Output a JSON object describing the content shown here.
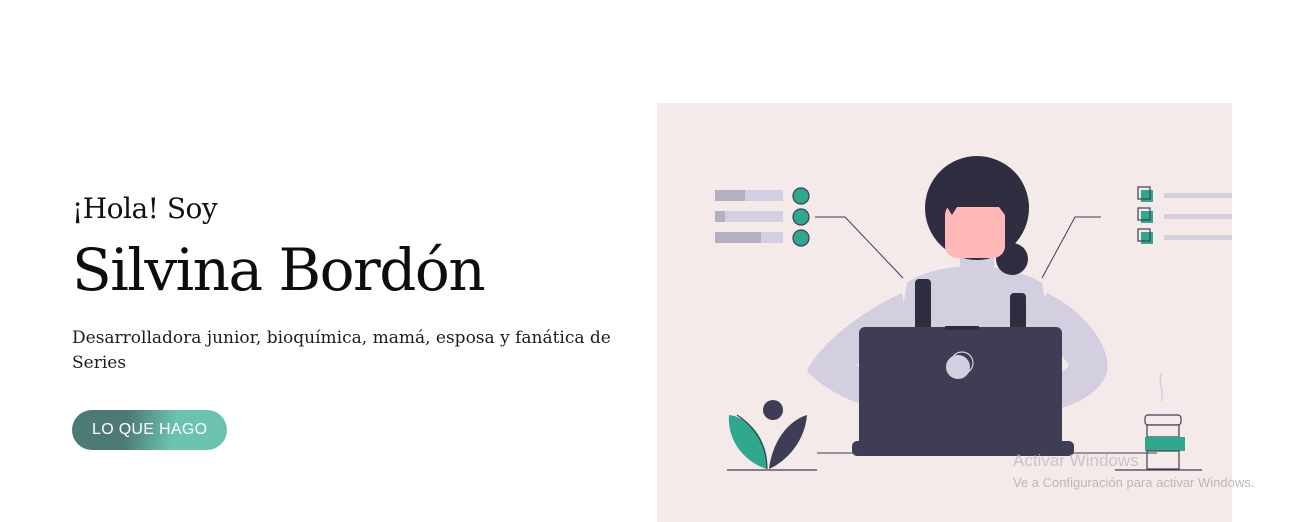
{
  "hero": {
    "greeting": "¡Hola! Soy",
    "name": "Silvina Bordón",
    "tagline": "Desarrolladora junior, bioquímica, mamá, esposa y fanática de Series",
    "cta_label": "LO QUE HAGO"
  },
  "illustration": {
    "subject": "woman-working-on-laptop",
    "background_color": "#f5eaea",
    "accent_color": "#2fa88e",
    "dark_color": "#3f3d56"
  },
  "os_watermark": {
    "title": "Activar Windows",
    "subtitle": "Ve a Configuración para activar Windows."
  },
  "colors": {
    "button_start": "#4d7a73",
    "button_end": "#6bc2b1",
    "text": "#111111"
  }
}
